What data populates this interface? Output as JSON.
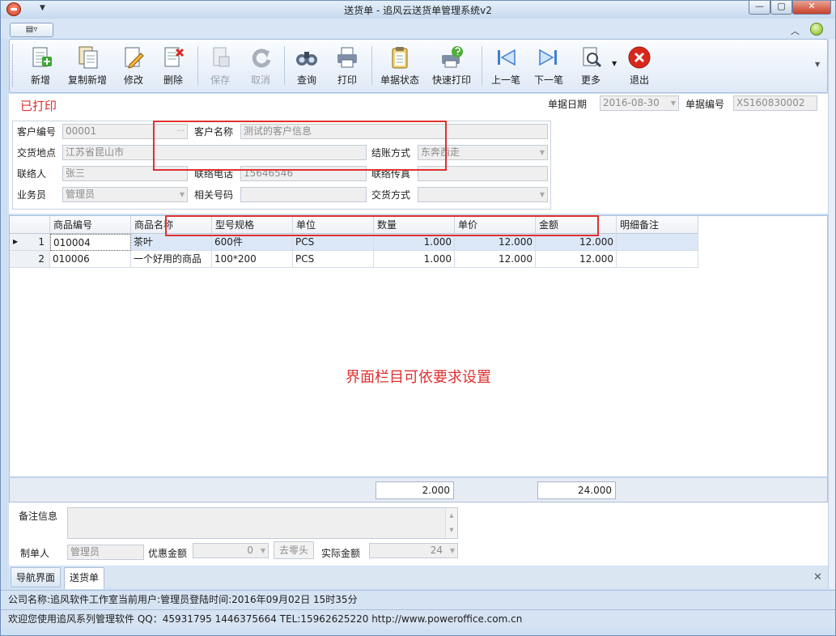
{
  "window": {
    "title": "送货单 - 追风云送货单管理系统v2"
  },
  "toolbar": {
    "new": "新增",
    "copy_new": "复制新增",
    "edit": "修改",
    "delete": "删除",
    "save": "保存",
    "cancel": "取消",
    "query": "查询",
    "print": "打印",
    "doc_status": "单据状态",
    "quick_print": "快速打印",
    "prev": "上一笔",
    "next": "下一笔",
    "more": "更多",
    "exit": "退出"
  },
  "form": {
    "status": "已打印",
    "doc_date_label": "单据日期",
    "doc_date": "2016-08-30",
    "doc_no_label": "单据编号",
    "doc_no": "XS160830002",
    "customer_code_label": "客户编号",
    "customer_code": "00001",
    "customer_name_label": "客户名称",
    "customer_name": "测试的客户信息",
    "delivery_address_label": "交货地点",
    "delivery_address": "江苏省昆山市",
    "settlement_label": "结账方式",
    "settlement": "东奔西走",
    "contact_label": "联络人",
    "contact": "张三",
    "phone_label": "联络电话",
    "phone": "15646546",
    "fax_label": "联络传真",
    "fax": "",
    "salesman_label": "业务员",
    "salesman": "管理员",
    "ref_no_label": "相关号码",
    "ref_no": "",
    "delivery_method_label": "交货方式",
    "delivery_method": ""
  },
  "grid": {
    "headers": [
      "商品编号",
      "商品名称",
      "型号规格",
      "单位",
      "数量",
      "单价",
      "金额",
      "明细备注"
    ],
    "rows": [
      {
        "no": "1",
        "code": "010004",
        "name": "茶叶",
        "spec": "600件",
        "unit": "PCS",
        "qty": "1.000",
        "price": "12.000",
        "amount": "12.000",
        "note": ""
      },
      {
        "no": "2",
        "code": "010006",
        "name": "一个好用的商品",
        "spec": "100*200",
        "unit": "PCS",
        "qty": "1.000",
        "price": "12.000",
        "amount": "12.000",
        "note": ""
      }
    ],
    "annotation": "界面栏目可依要求设置",
    "total_qty": "2.000",
    "total_amount": "24.000"
  },
  "bottom": {
    "remark_label": "备注信息",
    "remark": "",
    "creator_label": "制单人",
    "creator": "管理员",
    "discount_label": "优惠金额",
    "discount": "0",
    "round_button": "去零头",
    "actual_label": "实际金额",
    "actual": "24"
  },
  "tabs": [
    "导航界面",
    "送货单"
  ],
  "status": {
    "line1": "公司名称:追风软件工作室当前用户:管理员登陆时间:2016年09月02日 15时35分",
    "line2": "欢迎您使用追风系列管理软件 QQ：45931795 1446375664 TEL:15962625220 http://www.poweroffice.com.cn"
  },
  "colors": {
    "accent_red": "#e03030",
    "ribbon_blue": "#dfe9f6",
    "status_printed": "#e03030"
  }
}
